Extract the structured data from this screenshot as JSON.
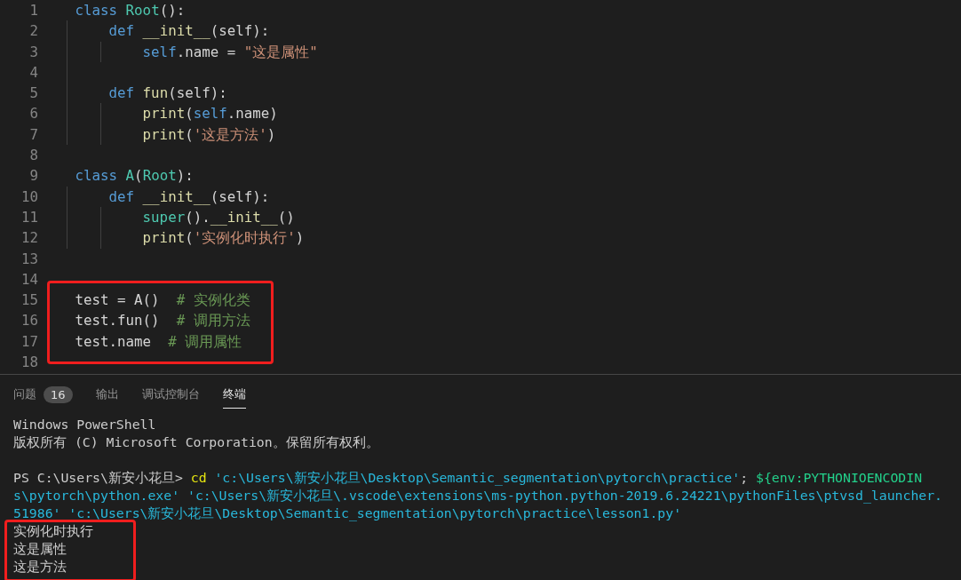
{
  "editor": {
    "lines": [
      {
        "number": "1",
        "highlighted": false,
        "tokens": [
          {
            "kind": "kw",
            "text": "class "
          },
          {
            "kind": "cls",
            "text": "Root"
          },
          {
            "kind": "txt",
            "text": "():"
          }
        ]
      },
      {
        "number": "2",
        "highlighted": false,
        "tokens": [
          {
            "kind": "kw",
            "text": "    def "
          },
          {
            "kind": "fn",
            "text": "__init__"
          },
          {
            "kind": "txt",
            "text": "(self):"
          }
        ]
      },
      {
        "number": "3",
        "highlighted": false,
        "tokens": [
          {
            "kind": "kw",
            "text": "        self"
          },
          {
            "kind": "txt",
            "text": ".name = "
          },
          {
            "kind": "str",
            "text": "\"这是属性\""
          }
        ]
      },
      {
        "number": "4",
        "highlighted": false
      },
      {
        "number": "5",
        "highlighted": false,
        "tokens": [
          {
            "kind": "kw",
            "text": "    def "
          },
          {
            "kind": "fn",
            "text": "fun"
          },
          {
            "kind": "txt",
            "text": "(self):"
          }
        ]
      },
      {
        "number": "6",
        "highlighted": false,
        "tokens": [
          {
            "kind": "fn",
            "text": "        print"
          },
          {
            "kind": "txt",
            "text": "("
          },
          {
            "kind": "kw",
            "text": "self"
          },
          {
            "kind": "txt",
            "text": ".name)"
          }
        ]
      },
      {
        "number": "7",
        "highlighted": false,
        "tokens": [
          {
            "kind": "fn",
            "text": "        print"
          },
          {
            "kind": "txt",
            "text": "("
          },
          {
            "kind": "str",
            "text": "'这是方法'"
          },
          {
            "kind": "txt",
            "text": ")"
          }
        ]
      },
      {
        "number": "8",
        "highlighted": false
      },
      {
        "number": "9",
        "highlighted": false,
        "tokens": [
          {
            "kind": "kw",
            "text": "class "
          },
          {
            "kind": "cls",
            "text": "A"
          },
          {
            "kind": "txt",
            "text": "("
          },
          {
            "kind": "cls",
            "text": "Root"
          },
          {
            "kind": "txt",
            "text": "):"
          }
        ]
      },
      {
        "number": "10",
        "highlighted": false,
        "tokens": [
          {
            "kind": "kw",
            "text": "    def "
          },
          {
            "kind": "fn",
            "text": "__init__"
          },
          {
            "kind": "txt",
            "text": "(self):"
          }
        ]
      },
      {
        "number": "11",
        "highlighted": false,
        "tokens": [
          {
            "kind": "cls",
            "text": "        super"
          },
          {
            "kind": "txt",
            "text": "()."
          },
          {
            "kind": "fn",
            "text": "__init__"
          },
          {
            "kind": "txt",
            "text": "()"
          }
        ]
      },
      {
        "number": "12",
        "highlighted": false,
        "tokens": [
          {
            "kind": "fn",
            "text": "        print"
          },
          {
            "kind": "txt",
            "text": "("
          },
          {
            "kind": "str",
            "text": "'实例化时执行'"
          },
          {
            "kind": "txt",
            "text": ")"
          }
        ]
      },
      {
        "number": "13",
        "highlighted": false
      },
      {
        "number": "14",
        "highlighted": false
      },
      {
        "number": "15",
        "highlighted": true,
        "tokens": [
          {
            "kind": "txt",
            "text": "test = A()  "
          },
          {
            "kind": "cmt",
            "text": "# 实例化类"
          }
        ]
      },
      {
        "number": "16",
        "highlighted": true,
        "tokens": [
          {
            "kind": "txt",
            "text": "test.fun()  "
          },
          {
            "kind": "cmt",
            "text": "# 调用方法"
          }
        ]
      },
      {
        "number": "17",
        "highlighted": true,
        "tokens": [
          {
            "kind": "txt",
            "text": "test.name  "
          },
          {
            "kind": "cmt",
            "text": "# 调用属性"
          }
        ]
      },
      {
        "number": "18",
        "highlighted": false
      }
    ]
  },
  "panel": {
    "tabs": [
      {
        "label": "问题",
        "badge": "16",
        "selected": false
      },
      {
        "label": "输出",
        "selected": false
      },
      {
        "label": "调试控制台",
        "selected": false
      },
      {
        "label": "终端",
        "selected": true
      }
    ],
    "terminal": [
      {
        "highlighted": false,
        "segments": [
          {
            "kind": "txt",
            "text": "Windows PowerShell"
          }
        ]
      },
      {
        "highlighted": false,
        "segments": [
          {
            "kind": "txt",
            "text": "版权所有 (C) Microsoft Corporation。保留所有权利。"
          }
        ]
      },
      {
        "highlighted": false
      },
      {
        "highlighted": false,
        "segments": [
          {
            "kind": "txt",
            "text": "PS C:\\Users\\新安小花旦> "
          },
          {
            "kind": "cmd",
            "text": "cd"
          },
          {
            "kind": "path",
            "text": " 'c:\\Users\\新安小花旦\\Desktop\\Semantic_segmentation\\pytorch\\practice'"
          },
          {
            "kind": "txt",
            "text": "; "
          },
          {
            "kind": "var",
            "text": "${env:PYTHONIOENCODIN"
          }
        ]
      },
      {
        "highlighted": false,
        "segments": [
          {
            "kind": "path",
            "text": "s\\pytorch\\python.exe' 'c:\\Users\\新安小花旦\\.vscode\\extensions\\ms-python.python-2019.6.24221\\pythonFiles\\ptvsd_launcher."
          }
        ]
      },
      {
        "highlighted": false,
        "segments": [
          {
            "kind": "path",
            "text": "51986' 'c:\\Users\\新安小花旦\\Desktop\\Semantic_segmentation\\pytorch\\practice\\lesson1.py'"
          }
        ]
      },
      {
        "highlighted": true,
        "segments": [
          {
            "kind": "txt",
            "text": "实例化时执行"
          }
        ]
      },
      {
        "highlighted": true,
        "segments": [
          {
            "kind": "txt",
            "text": "这是属性"
          }
        ]
      },
      {
        "highlighted": true,
        "segments": [
          {
            "kind": "txt",
            "text": "这是方法"
          }
        ]
      }
    ]
  }
}
